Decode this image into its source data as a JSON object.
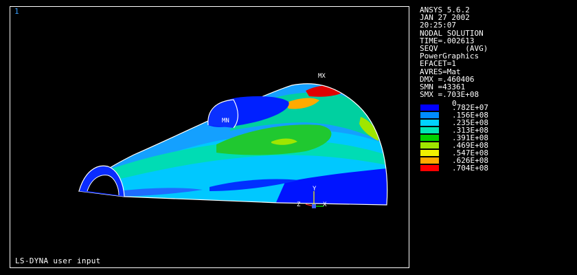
{
  "viewport": {
    "window_number": "1",
    "status_text": "LS-DYNA user input",
    "max_label": "MX",
    "min_label": "MN",
    "axis_labels": {
      "y": "Y",
      "x": "X",
      "z": "Z"
    }
  },
  "info": {
    "lines": [
      "ANSYS 5.6.2",
      "JAN 27 2002",
      "20:25:07",
      "NODAL SOLUTION",
      "TIME=.002613",
      "SEQV      (AVG)",
      "PowerGraphics",
      "EFACET=1",
      "AVRES=Mat",
      "DMX =.460406",
      "SMN =43361",
      "SMX =.703E+08"
    ]
  },
  "legend": {
    "zero_label": "0",
    "entries": [
      {
        "color": "#0000ff",
        "value": ".782E+07"
      },
      {
        "color": "#008cff",
        "value": ".156E+08"
      },
      {
        "color": "#00d2ff",
        "value": ".235E+08"
      },
      {
        "color": "#00e6b4",
        "value": ".313E+08"
      },
      {
        "color": "#00d200",
        "value": ".391E+08"
      },
      {
        "color": "#a0e600",
        "value": ".469E+08"
      },
      {
        "color": "#f0f000",
        "value": ".547E+08"
      },
      {
        "color": "#ffaa00",
        "value": ".626E+08"
      },
      {
        "color": "#ff0000",
        "value": ".704E+08"
      }
    ]
  },
  "colors": {
    "background": "#000000",
    "frame": "#ffffff",
    "window_number": "#3aa0ff"
  }
}
